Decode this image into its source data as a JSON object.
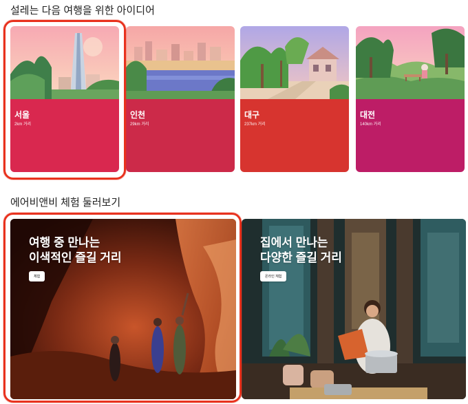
{
  "sections": {
    "inspiration_title": "설레는 다음 여행을 위한 아이디어",
    "experiences_title": "에어비앤비 체험 둘러보기"
  },
  "destinations": [
    {
      "name": "서울",
      "distance": "2km 거리",
      "color": "#d9284f",
      "selected": true
    },
    {
      "name": "인천",
      "distance": "29km 거리",
      "color": "#cc2a49",
      "selected": false
    },
    {
      "name": "대구",
      "distance": "237km 거리",
      "color": "#d7342f",
      "selected": false
    },
    {
      "name": "대전",
      "distance": "140km 거리",
      "color": "#bd1d66",
      "selected": false
    }
  ],
  "experiences": [
    {
      "title_line1": "여행 중 만나는",
      "title_line2": "이색적인 즐길 거리",
      "button": "체험",
      "selected": true
    },
    {
      "title_line1": "집에서 만나는",
      "title_line2": "다양한 즐길 거리",
      "button": "온라인 체험",
      "selected": false
    }
  ],
  "colors": {
    "selection_outline": "#e8321e"
  }
}
